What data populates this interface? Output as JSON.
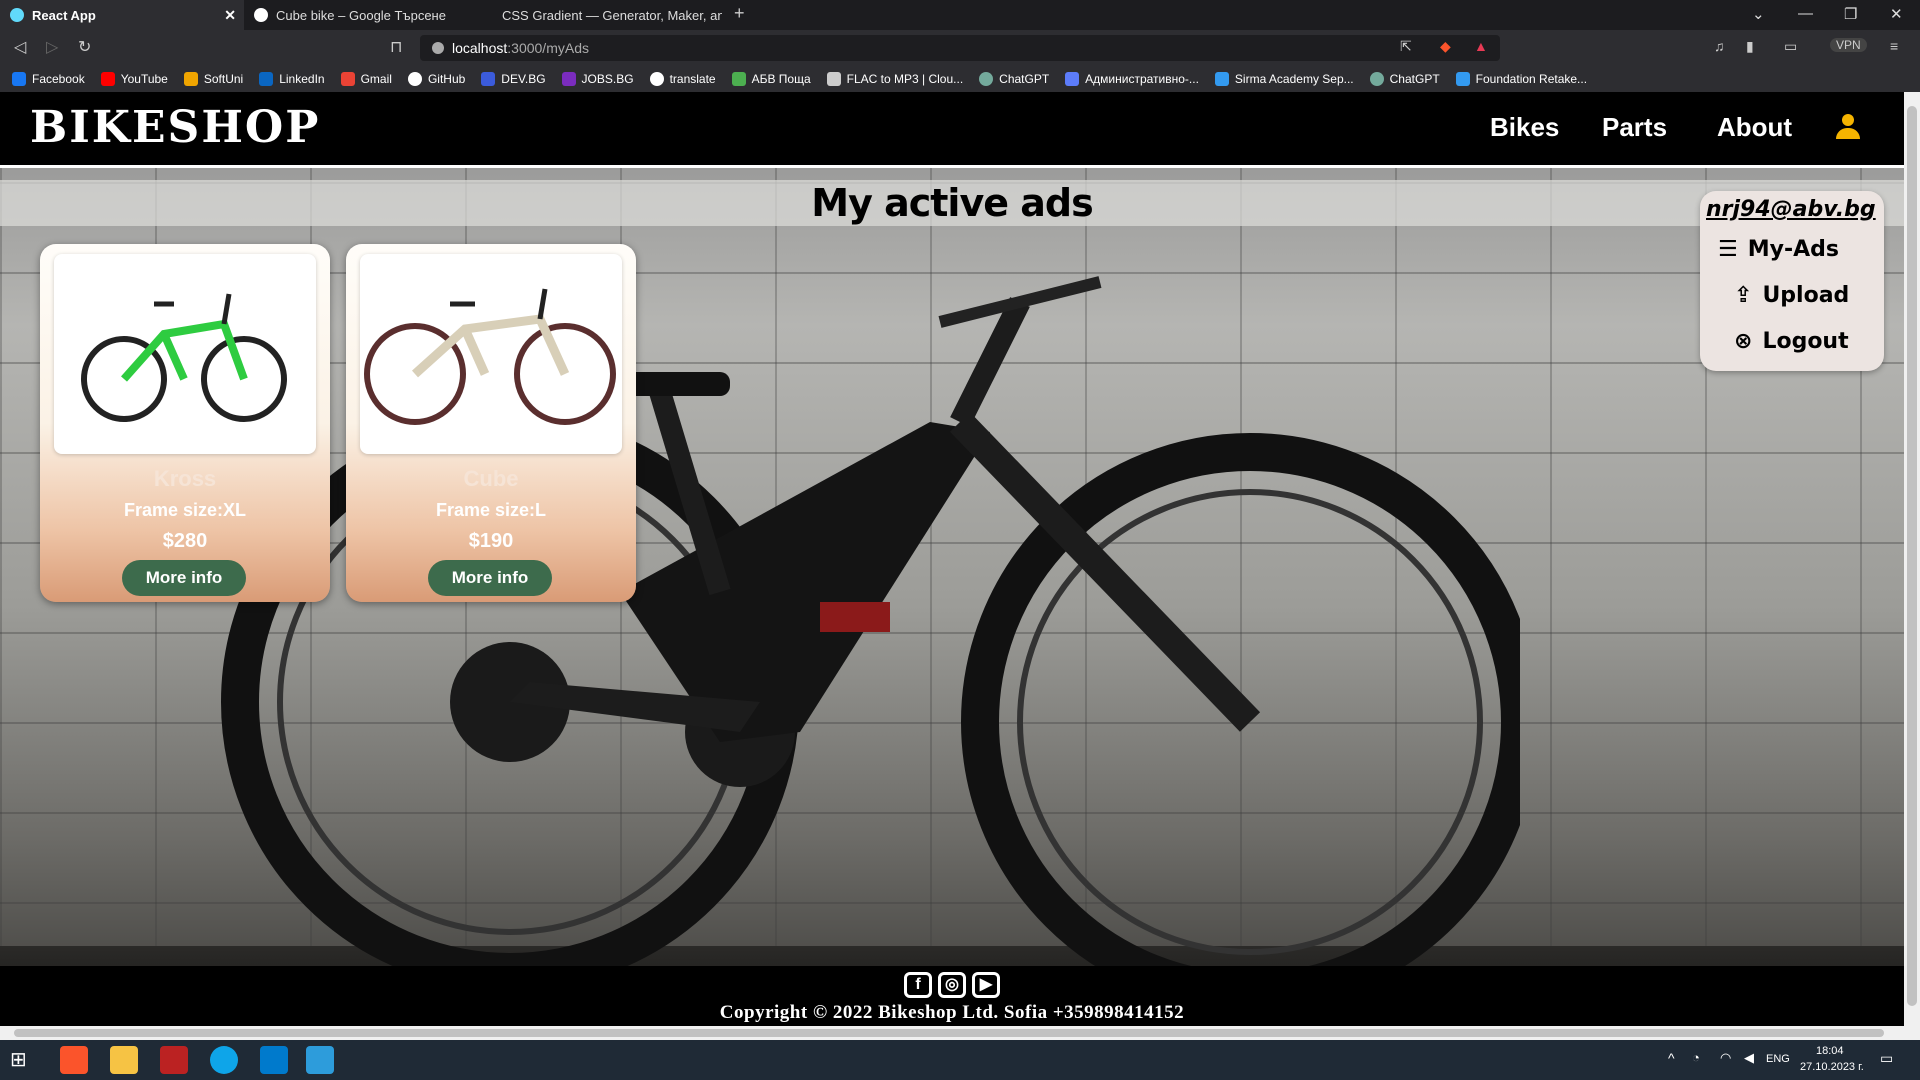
{
  "browser": {
    "tabs": [
      {
        "label": "React App",
        "active": true
      },
      {
        "label": "Cube bike – Google Търсене",
        "active": false
      },
      {
        "label": "CSS Gradient — Generator, Maker, and",
        "active": false
      }
    ],
    "url_host": "localhost",
    "url_path": ":3000/myAds",
    "vpn_label": "VPN",
    "bookmarks": [
      "Facebook",
      "YouTube",
      "SoftUni",
      "LinkedIn",
      "Gmail",
      "GitHub",
      "DEV.BG",
      "JOBS.BG",
      "translate",
      "АБВ Поща",
      "FLAC to MP3 | Clou...",
      "ChatGPT",
      "Административно-...",
      "Sirma Academy Sep...",
      "ChatGPT",
      "Foundation Retake..."
    ]
  },
  "site": {
    "logo": "BIKESHOP",
    "nav": [
      "Bikes",
      "Parts",
      "About"
    ],
    "page_title": "My active ads",
    "user_menu": {
      "email": "nrj94@abv.bg",
      "items": [
        "My-Ads",
        "Upload",
        "Logout"
      ]
    },
    "ads": [
      {
        "name": "Kross",
        "size": "Frame size:XL",
        "price": "$280",
        "button": "More info"
      },
      {
        "name": "Cube",
        "size": "Frame size:L",
        "price": "$190",
        "button": "More info"
      }
    ],
    "footer": {
      "copyright": "Copyright © 2022 Bikeshop Ltd. Sofia +359898414152"
    }
  },
  "taskbar": {
    "lang": "ENG",
    "time": "18:04",
    "date": "27.10.2023 г."
  },
  "colors": {
    "accent_user": "#f5b400",
    "button_green": "#3d6b4c"
  }
}
